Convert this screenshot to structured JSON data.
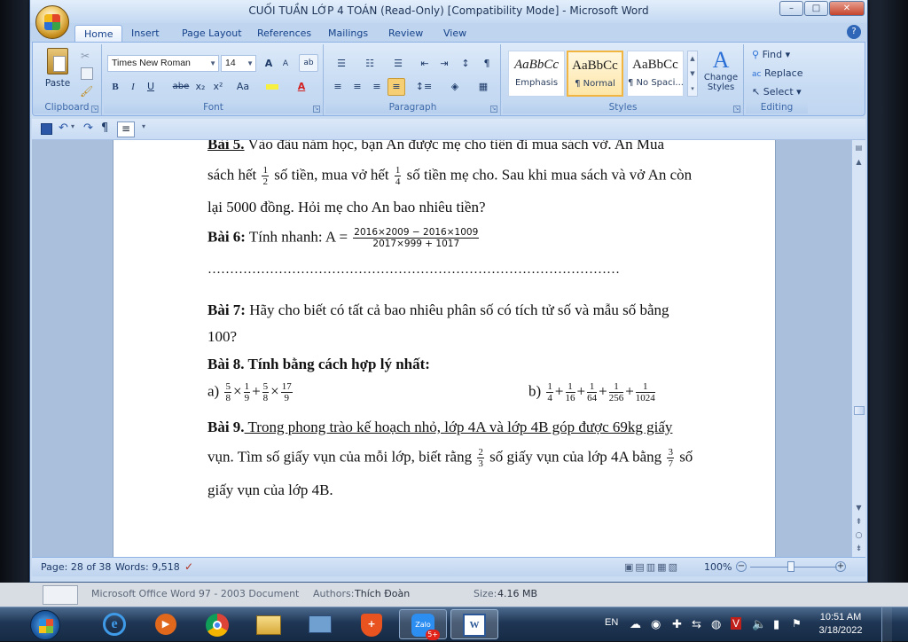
{
  "window": {
    "title": "CUỐI TUẦN LỚP 4 TOÁN  (Read-Only) [Compatibility Mode] - Microsoft Word",
    "minimize": "–",
    "maximize": "□",
    "close": "✕",
    "help": "?"
  },
  "tabs": [
    "Home",
    "Insert",
    "Page Layout",
    "References",
    "Mailings",
    "Review",
    "View"
  ],
  "ribbon": {
    "clipboard": {
      "label": "Clipboard",
      "paste": "Paste"
    },
    "font": {
      "label": "Font",
      "family": "Times New Roman",
      "size": "14",
      "bold": "B",
      "italic": "I",
      "underline": "U",
      "strike": "abe",
      "sub": "x₂",
      "sup": "x²",
      "case": "Aa",
      "grow": "A",
      "shrink": "A"
    },
    "paragraph": {
      "label": "Paragraph"
    },
    "styles": {
      "label": "Styles",
      "items": [
        {
          "sample": "AaBbCc",
          "name": "Emphasis"
        },
        {
          "sample": "AaBbCc",
          "name": "¶ Normal"
        },
        {
          "sample": "AaBbCc",
          "name": "¶ No Spaci..."
        }
      ],
      "change": "Change Styles"
    },
    "editing": {
      "label": "Editing",
      "find": "Find",
      "replace": "Replace",
      "select": "Select"
    }
  },
  "document": {
    "bai5": {
      "label": "Bài 5.",
      "line1": " Vào đầu năm học, bạn An được mẹ cho tiền đi mua sách vở. An Mua",
      "line2a": "sách hết ",
      "frac1": [
        "1",
        "2"
      ],
      "line2b": " số tiền, mua vở hết ",
      "frac2": [
        "1",
        "4"
      ],
      "line2c": " số tiền mẹ cho. Sau khi mua sách và vở An còn",
      "line3": "lại 5000 đồng. Hỏi mẹ cho An bao nhiêu tiền?"
    },
    "bai6": {
      "label": "Bài 6:",
      "text": " Tính nhanh: A = ",
      "num": "2016×2009 − 2016×1009",
      "den": "2017×999 + 1017"
    },
    "dots": "…………………………………………………………………………………",
    "bai7": {
      "label": "Bài 7:",
      "line1": " Hãy cho biết có tất cả bao nhiêu phân số có tích tử số và mẫu số bằng",
      "line2": "100?"
    },
    "bai8": {
      "label": "Bài 8. Tính bằng cách hợp lý nhất:",
      "a_label": "a)",
      "a_terms": [
        [
          "5",
          "8"
        ],
        [
          "1",
          "9"
        ],
        [
          "5",
          "8"
        ],
        [
          "17",
          "9"
        ]
      ],
      "a_ops": [
        "×",
        "+",
        "×"
      ],
      "b_label": "b)",
      "b_terms": [
        [
          "1",
          "4"
        ],
        [
          "1",
          "16"
        ],
        [
          "1",
          "64"
        ],
        [
          "1",
          "256"
        ],
        [
          "1",
          "1024"
        ]
      ]
    },
    "bai9": {
      "label": "Bài 9.",
      "line1": " Trong phong trào kế hoạch nhỏ, lớp 4A và lớp 4B góp được 69kg giấy",
      "line2a": "vụn. Tìm số giấy vụn của mỗi lớp, biết rằng ",
      "frac1": [
        "2",
        "3"
      ],
      "line2b": " số giấy vụn của lớp 4A bằng ",
      "frac2": [
        "3",
        "7"
      ],
      "line2c": " số",
      "line3": "giấy vụn của lớp 4B."
    }
  },
  "status": {
    "page": "Page: 28 of 38",
    "words": "Words: 9,518",
    "zoom": "100%"
  },
  "explorer_details": {
    "type": "Microsoft Office Word 97 - 2003 Document",
    "authors_label": "Authors:",
    "authors": "Thích Đoàn",
    "size_label": "Size:",
    "size": "4.16 MB"
  },
  "taskbar": {
    "lang": "EN",
    "time": "10:51 AM",
    "date": "3/18/2022",
    "zalo": "Zalo",
    "zalo_badge": "5+"
  }
}
